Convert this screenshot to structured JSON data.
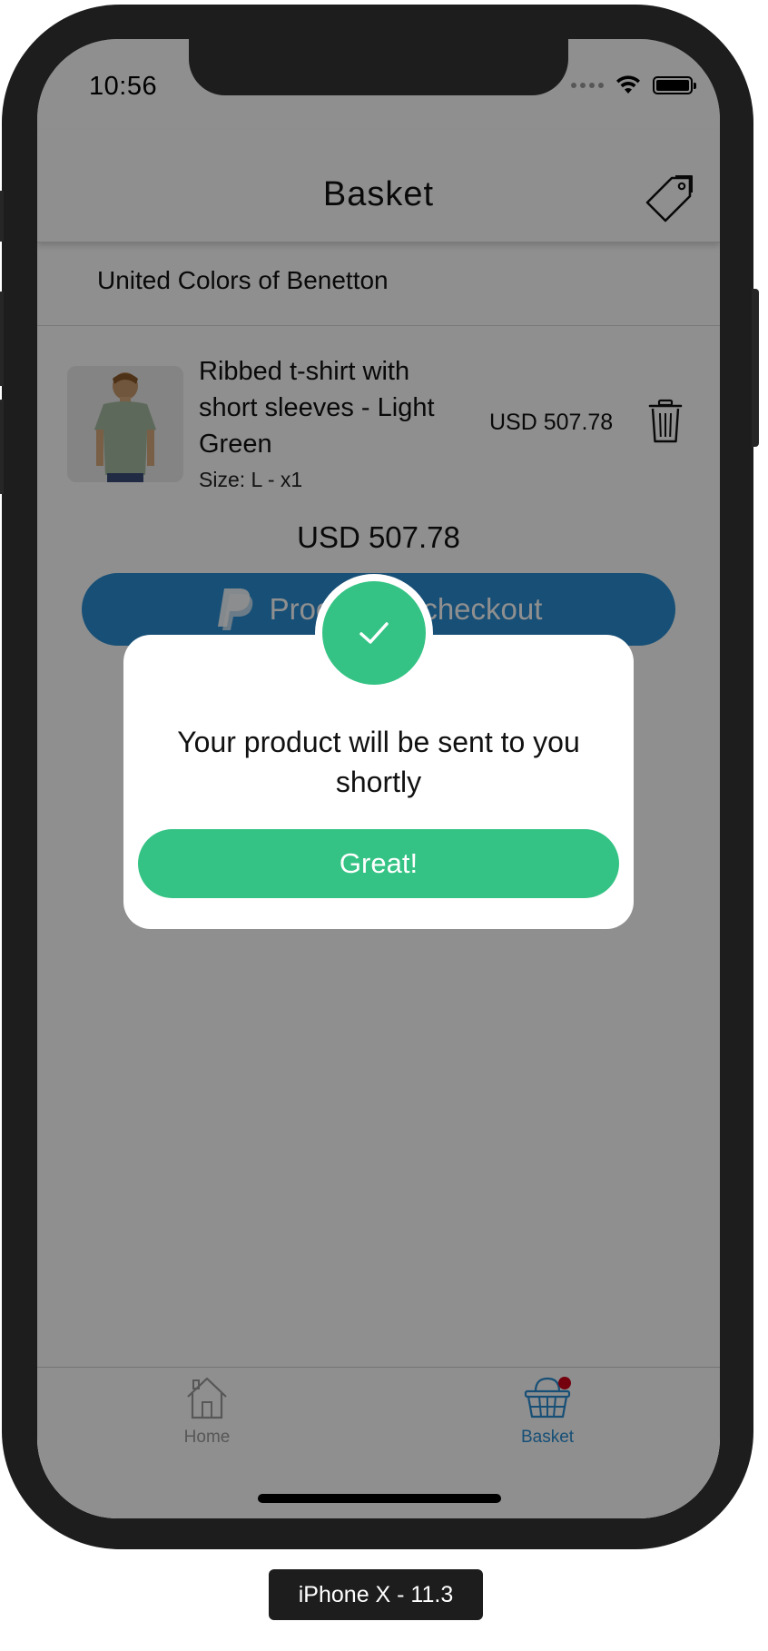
{
  "status_bar": {
    "time": "10:56"
  },
  "header": {
    "title": "Basket",
    "tag_icon": "tag-icon"
  },
  "basket": {
    "store_name": "United Colors of Benetton",
    "items": [
      {
        "name": "Ribbed t-shirt with short sleeves - Light Green",
        "size": "Size: L - x1",
        "price": "USD 507.78"
      }
    ],
    "total": "USD 507.78",
    "checkout_label": "Proceed to checkout"
  },
  "modal": {
    "message": "Your product will be sent to you shortly",
    "button_label": "Great!"
  },
  "tab_bar": {
    "tabs": [
      {
        "label": "Home",
        "icon": "home-icon",
        "active": false
      },
      {
        "label": "Basket",
        "icon": "basket-icon",
        "active": true
      }
    ]
  },
  "simulator_label": "iPhone X - 11.3",
  "colors": {
    "accent_blue": "#2a8ed3",
    "success_green": "#34c384",
    "badge_red": "#d0021b"
  }
}
